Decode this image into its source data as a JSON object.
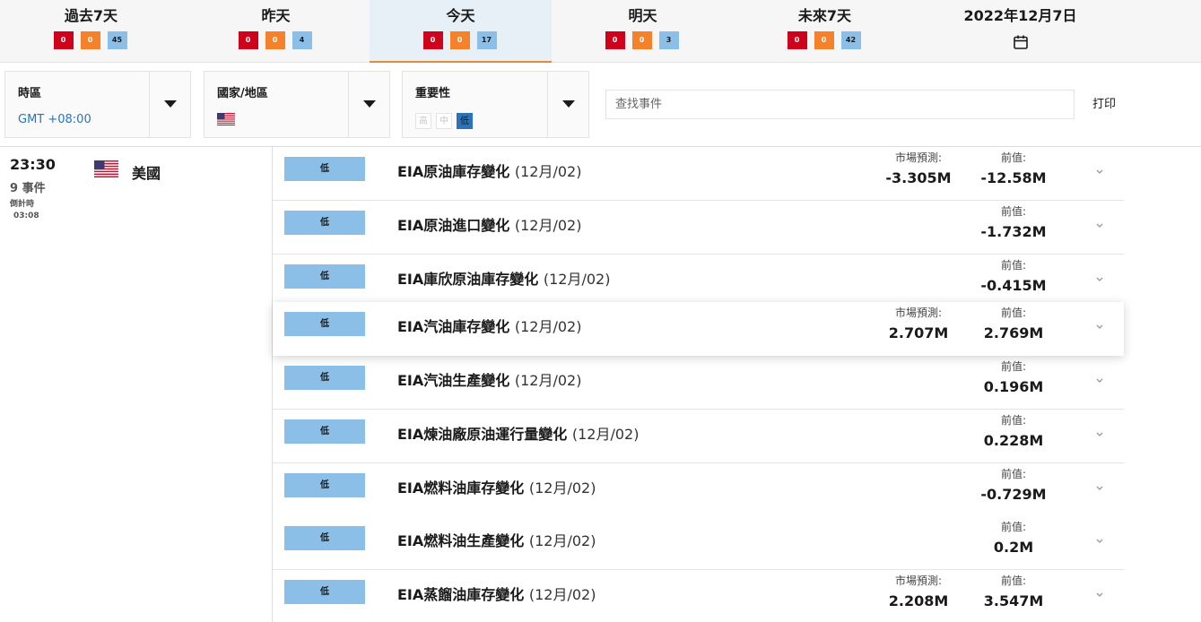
{
  "tabs": [
    {
      "label": "過去7天",
      "red": "0",
      "orange": "0",
      "blue": "45"
    },
    {
      "label": "昨天",
      "red": "0",
      "orange": "0",
      "blue": "4"
    },
    {
      "label": "今天",
      "red": "0",
      "orange": "0",
      "blue": "17"
    },
    {
      "label": "明天",
      "red": "0",
      "orange": "0",
      "blue": "3"
    },
    {
      "label": "未來7天",
      "red": "0",
      "orange": "0",
      "blue": "42"
    }
  ],
  "date_tab": {
    "label": "2022年12月7日",
    "icon": "calendar-icon"
  },
  "filters": {
    "timezone": {
      "label": "時區",
      "value": "GMT +08:00"
    },
    "country": {
      "label": "國家/地區",
      "flag_icon": "us-flag-icon"
    },
    "importance": {
      "label": "重要性",
      "high": "高",
      "medium": "中",
      "low": "低"
    }
  },
  "search": {
    "placeholder": "查找事件"
  },
  "print_label": "打印",
  "group": {
    "time": "23:30",
    "event_count": "9 事件",
    "countdown_label": "倒計時",
    "countdown_value": "03:08",
    "country": "美國"
  },
  "labels": {
    "forecast": "市場預測:",
    "previous": "前值:"
  },
  "events": [
    {
      "importance": "低",
      "name": "EIA原油庫存變化",
      "period": "(12月/02)",
      "forecast": "-3.305M",
      "previous": "-12.58M"
    },
    {
      "importance": "低",
      "name": "EIA原油進口變化",
      "period": "(12月/02)",
      "forecast": "",
      "previous": "-1.732M"
    },
    {
      "importance": "低",
      "name": "EIA庫欣原油庫存變化",
      "period": "(12月/02)",
      "forecast": "",
      "previous": "-0.415M"
    },
    {
      "importance": "低",
      "name": "EIA汽油庫存變化",
      "period": "(12月/02)",
      "forecast": "2.707M",
      "previous": "2.769M"
    },
    {
      "importance": "低",
      "name": "EIA汽油生產變化",
      "period": "(12月/02)",
      "forecast": "",
      "previous": "0.196M"
    },
    {
      "importance": "低",
      "name": "EIA煉油廠原油運行量變化",
      "period": "(12月/02)",
      "forecast": "",
      "previous": "0.228M"
    },
    {
      "importance": "低",
      "name": "EIA燃料油庫存變化",
      "period": "(12月/02)",
      "forecast": "",
      "previous": "-0.729M"
    },
    {
      "importance": "低",
      "name": "EIA燃料油生產變化",
      "period": "(12月/02)",
      "forecast": "",
      "previous": "0.2M"
    },
    {
      "importance": "低",
      "name": "EIA蒸餾油庫存變化",
      "period": "(12月/02)",
      "forecast": "2.208M",
      "previous": "3.547M"
    }
  ],
  "colors": {
    "high": "#d0021b",
    "medium": "#f5822a",
    "low": "#8cbfe7",
    "accent": "#e68a3a",
    "link": "#2a73ba"
  }
}
